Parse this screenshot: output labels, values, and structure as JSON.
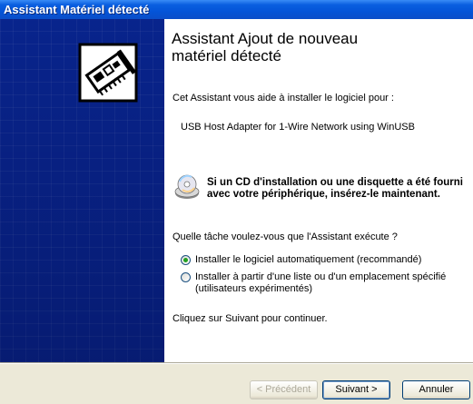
{
  "window": {
    "title": "Assistant Matériel détecté"
  },
  "wizard": {
    "heading_line1": "Assistant Ajout de nouveau",
    "heading_line2": "matériel détecté",
    "intro": "Cet Assistant vous aide à installer le logiciel pour :",
    "device_name": "USB Host Adapter for 1-Wire Network using WinUSB",
    "cd_note": "Si un CD d'installation ou une disquette a été fourni avec votre périphérique, insérez-le maintenant.",
    "question": "Quelle tâche voulez-vous que l'Assistant exécute ?",
    "options": [
      {
        "label": "Installer le logiciel automatiquement (recommandé)",
        "selected": true
      },
      {
        "label": "Installer à partir d'une liste ou d'un emplacement spécifié (utilisateurs expérimentés)",
        "selected": false
      }
    ],
    "continue_hint": "Cliquez sur Suivant pour continuer."
  },
  "buttons": {
    "previous": "< Précédent",
    "next": "Suivant >",
    "cancel": "Annuler"
  },
  "icons": {
    "hardware": "hardware-card-icon",
    "cd": "cd-disc-icon"
  },
  "colors": {
    "titlebar": "#0454d8",
    "side_panel": "#0a2a9a",
    "dialog_bg": "#ece9d8",
    "radio_selected": "#21a121"
  }
}
